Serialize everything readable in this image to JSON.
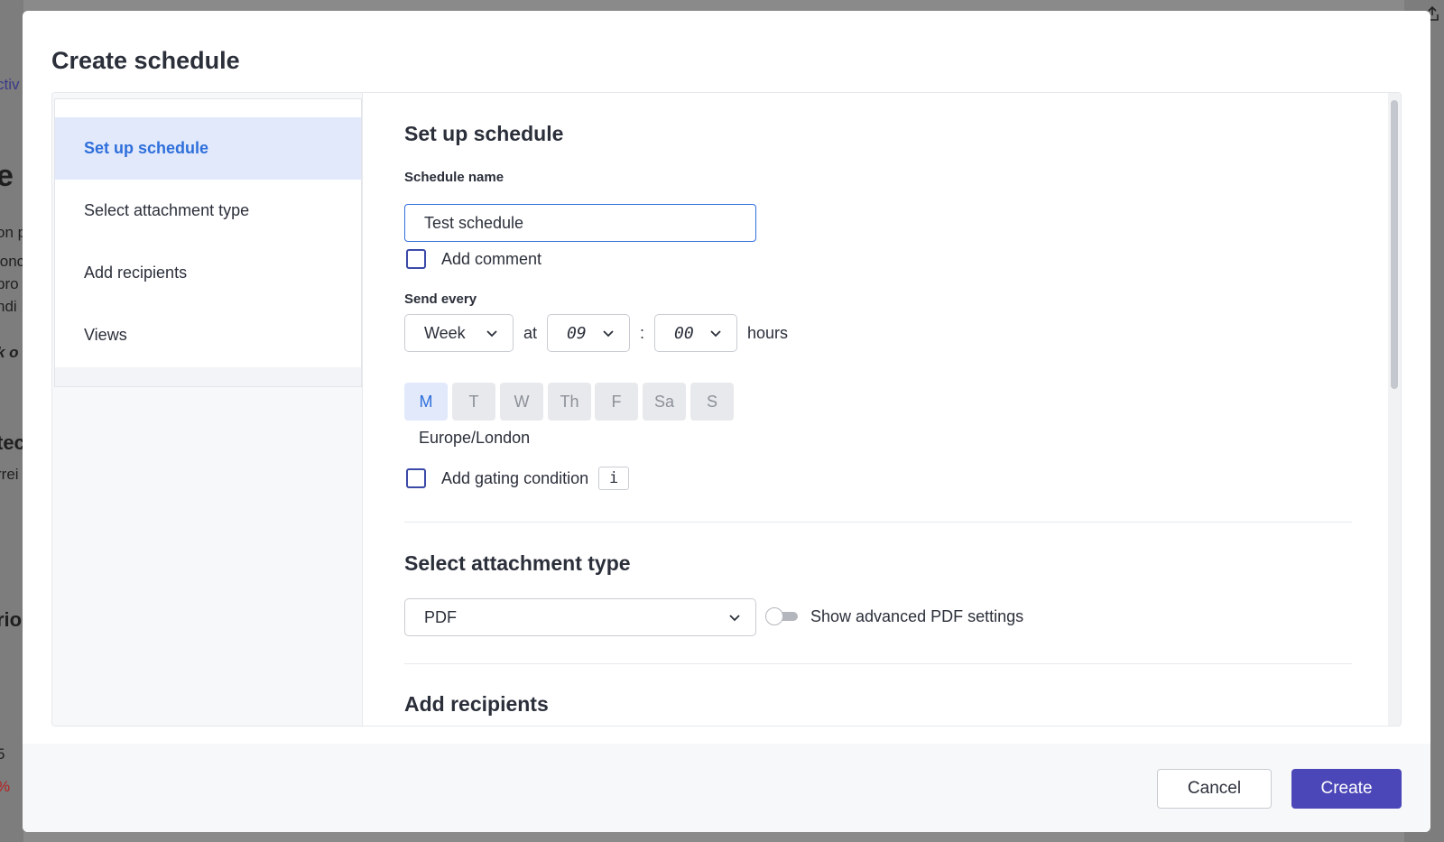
{
  "modal": {
    "title": "Create schedule"
  },
  "sidebar": {
    "items": [
      {
        "label": "Set up schedule",
        "active": true
      },
      {
        "label": "Select attachment type",
        "active": false
      },
      {
        "label": "Add recipients",
        "active": false
      },
      {
        "label": "Views",
        "active": false
      }
    ]
  },
  "setup": {
    "title": "Set up schedule",
    "name_label": "Schedule name",
    "name_value": "Test schedule",
    "add_comment_label": "Add comment",
    "add_comment_checked": false,
    "send_every_label": "Send every",
    "frequency": "Week",
    "at_label": "at",
    "hour": "09",
    "colon": ":",
    "minute": "00",
    "hours_label": "hours",
    "days": [
      {
        "label": "M",
        "selected": true
      },
      {
        "label": "T",
        "selected": false
      },
      {
        "label": "W",
        "selected": false
      },
      {
        "label": "Th",
        "selected": false
      },
      {
        "label": "F",
        "selected": false
      },
      {
        "label": "Sa",
        "selected": false
      },
      {
        "label": "S",
        "selected": false
      }
    ],
    "timezone": "Europe/London",
    "gating_label": "Add gating condition",
    "gating_checked": false,
    "info_label": "i"
  },
  "attachment": {
    "title": "Select attachment type",
    "type_value": "PDF",
    "advanced_label": "Show advanced PDF settings",
    "advanced_enabled": false
  },
  "recipients": {
    "title": "Add recipients"
  },
  "footer": {
    "cancel_label": "Cancel",
    "create_label": "Create"
  },
  "background": {
    "fragments": [
      "ctiv",
      "e",
      "on p",
      "lonc",
      "pro",
      "ndi",
      "k o",
      "tec",
      "rrei",
      "rio",
      "5",
      "%"
    ]
  },
  "colors": {
    "accent": "#2f6fdb",
    "primary_button": "#4b47b8",
    "active_nav_bg": "#e1e9fb"
  }
}
